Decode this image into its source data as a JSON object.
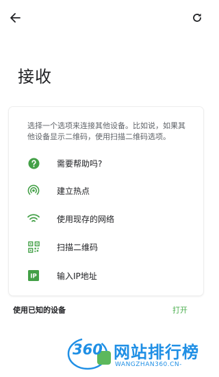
{
  "header": {
    "back_icon": "arrow-left-icon",
    "refresh_icon": "refresh-icon"
  },
  "page": {
    "title": "接收"
  },
  "card": {
    "description": "选择一个选项来连接其他设备。比如说，如果其他设备显示二维码，使用扫描二维码选项。",
    "options": [
      {
        "label": "需要帮助吗?",
        "icon": "help-icon"
      },
      {
        "label": "建立热点",
        "icon": "hotspot-icon"
      },
      {
        "label": "使用现存的网络",
        "icon": "wifi-icon"
      },
      {
        "label": "扫描二维码",
        "icon": "qr-code-icon"
      },
      {
        "label": "输入IP地址",
        "icon": "ip-icon"
      }
    ]
  },
  "footer": {
    "known_devices_label": "使用已知的设备",
    "open_label": "打开"
  },
  "watermark": {
    "logo_text": "360",
    "main_text": "网站排行榜",
    "sub_text": "WANGZHAN360.CN-"
  },
  "colors": {
    "accent_green": "#43a047",
    "link_green": "#4caf50",
    "watermark_blue": "#1f8fe5"
  }
}
